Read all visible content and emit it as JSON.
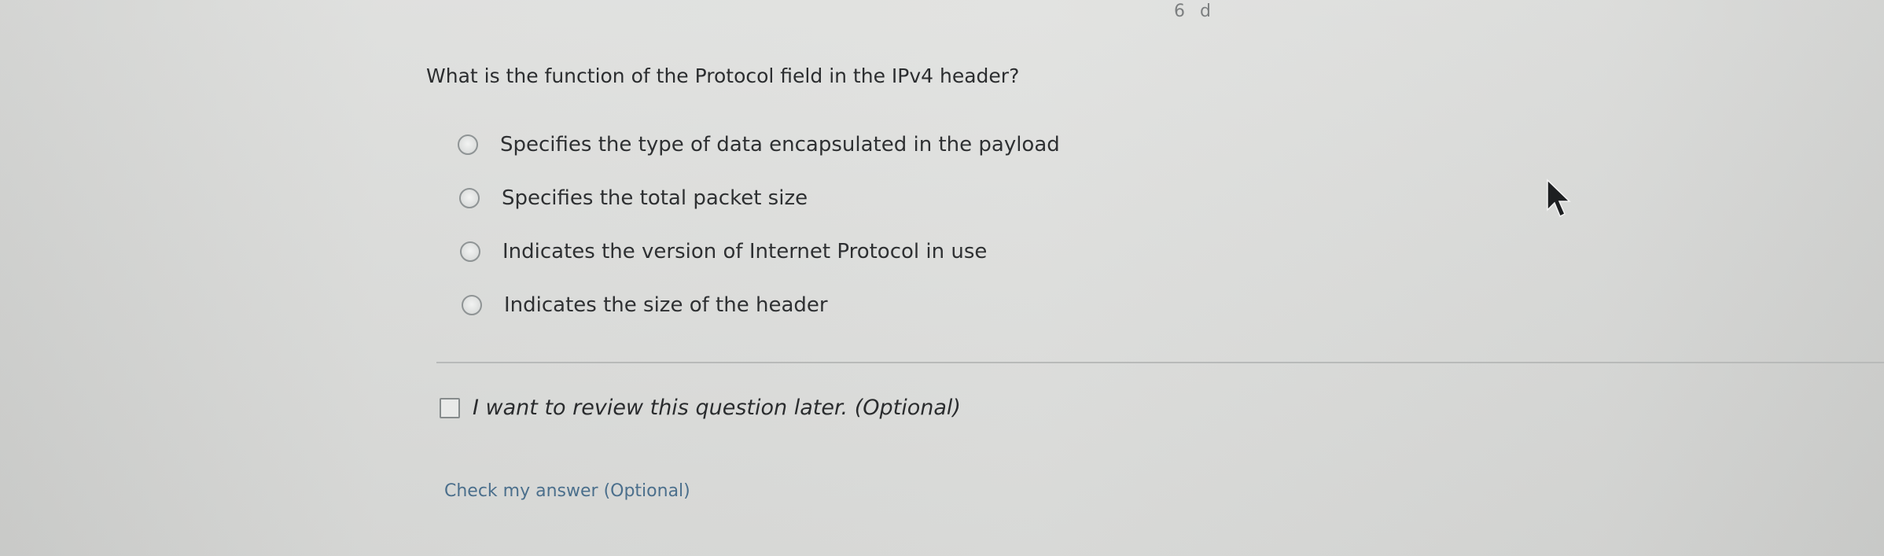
{
  "corner_text": "6 d",
  "question": {
    "text": "What is the function of the Protocol field in the IPv4 header?"
  },
  "options": [
    {
      "label": "Specifies the type of data encapsulated in the payload",
      "selected": false
    },
    {
      "label": "Specifies the total packet size",
      "selected": false
    },
    {
      "label": "Indicates the version of Internet Protocol in use",
      "selected": false
    },
    {
      "label": "Indicates the size of the header",
      "selected": false
    }
  ],
  "review": {
    "label": "I want to review this question later. (Optional)",
    "checked": false
  },
  "check_answer": {
    "label": "Check my answer (Optional)"
  },
  "colors": {
    "background": "#dcdddb",
    "text": "#2e3032",
    "link": "#4b6f8c"
  }
}
